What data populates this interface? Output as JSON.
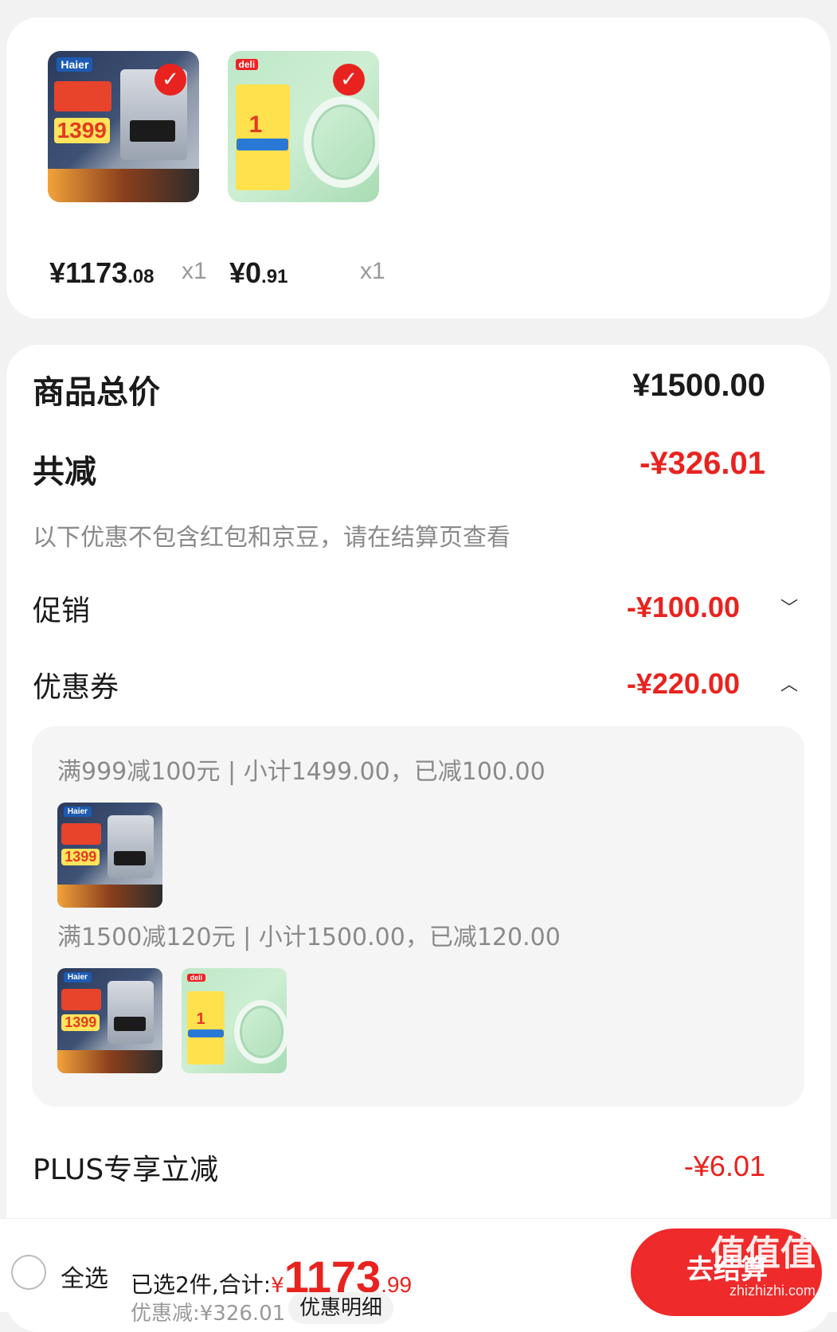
{
  "cart_items": [
    {
      "brand": "Haier",
      "promo_price": "1399",
      "price_int": "¥1173",
      "price_dec": ".08",
      "qty": "x1"
    },
    {
      "brand": "deli",
      "promo_price": "1",
      "price_int": "¥0",
      "price_dec": ".91",
      "qty": "x1"
    }
  ],
  "summary": {
    "total_label": "商品总价",
    "total_value": "¥1500.00",
    "reduction_label": "共减",
    "reduction_value": "-¥326.01",
    "note": "以下优惠不包含红包和京豆，请在结算页查看",
    "promo_label": "促销",
    "promo_value": "-¥100.00",
    "coupon_label": "优惠券",
    "coupon_value": "-¥220.00",
    "plus_label": "PLUS专享立减",
    "plus_value": "-¥6.01"
  },
  "coupons": [
    {
      "title": "满999减100元 | 小计1499.00，已减100.00"
    },
    {
      "title": "满1500减120元 | 小计1500.00，已减120.00"
    }
  ],
  "bottom_bar": {
    "select_all": "全选",
    "selected_text": "已选2件,合计:",
    "currency": "¥",
    "total_int": "1173",
    "total_dec": ".99",
    "discount_text": "优惠减:¥326.01",
    "detail_button": "优惠明细",
    "checkout": "去结算",
    "watermark_cn": "值值值",
    "watermark_url": "zhizhizhi.com"
  },
  "colors": {
    "accent": "#e8231f",
    "background": "#f2f2f2"
  }
}
